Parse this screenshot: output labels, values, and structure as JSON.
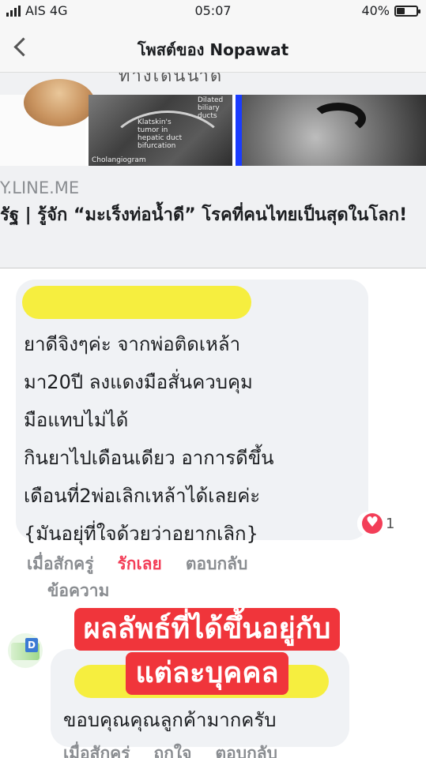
{
  "status": {
    "carrier": "AIS 4G",
    "time": "05:07",
    "battery": "40%",
    "battery_level": 0.4
  },
  "nav": {
    "title": "โพสต์ของ Nopawat"
  },
  "share": {
    "cut_text": "ทางเดินน้ำดี",
    "image_labels": {
      "dilated": "Dilated biliary ducts",
      "tumor": "Klatskin's tumor in hepatic duct bifurcation",
      "caption": "Cholangiogram"
    },
    "domain": "Y.LINE.ME",
    "title": "รัฐ | รู้จัก “มะเร็งท่อน้ำดี” โรคที่คนไทยเป็นสุดในโลก!"
  },
  "comment1": {
    "lines": [
      "ยาดีจิงๆค่ะ จากพ่อติดเหล้า",
      "มา20ปี ลงแดงมือสั่นควบคุม",
      "มือแทบไม่ได้",
      "กินยาไปเดือนเดียว อาการดีขึ้น",
      "เดือนที่2พ่อเลิกเหล้าได้เลยค่ะ",
      "{มันอยุ่ที่ใจด้วยว่าอยากเลิก}"
    ],
    "reaction_count": "1",
    "time": "เมื่อสักครู่",
    "love": "รักเลย",
    "reply": "ตอบกลับ",
    "message": "ข้อความ"
  },
  "banner": {
    "line1": "ผลลัพธ์ที่ได้ขึ้นอยู่กับ",
    "line2": "แต่ละบุคคล"
  },
  "comment2": {
    "avatar_tag": "D",
    "text": "ขอบคุณคุณลูกค้ามากครับ",
    "time": "เมื่อสักครู่",
    "like": "ถูกใจ",
    "reply": "ตอบกลับ"
  },
  "colors": {
    "love_red": "#f33e58",
    "banner_red": "#f0353b",
    "redaction_yellow": "#f6ee3f",
    "bubble_gray": "#f0f2f5"
  }
}
